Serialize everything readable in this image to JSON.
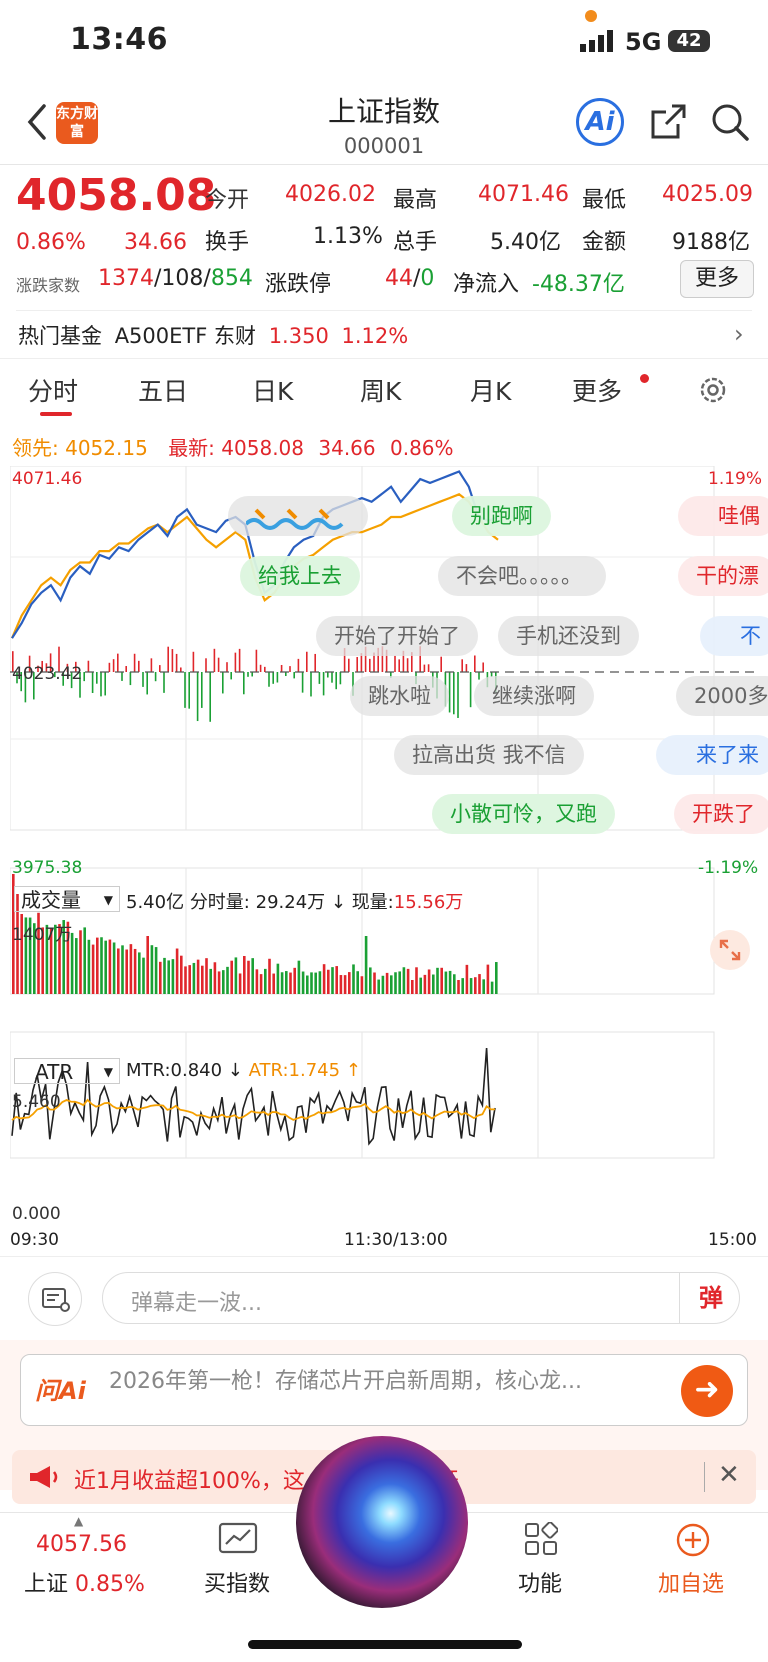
{
  "status_bar": {
    "time": "13:46",
    "network": "5G",
    "battery": "42"
  },
  "header": {
    "logo": "东方财富",
    "title": "上证指数",
    "code": "000001"
  },
  "quote": {
    "price": "4058.08",
    "change_pct": "0.86%",
    "change_amt": "34.66",
    "rows": [
      [
        {
          "label": "今开",
          "value": "4026.02"
        },
        {
          "label": "最高",
          "value": "4071.46"
        },
        {
          "label": "最低",
          "value": "4025.09"
        }
      ],
      [
        {
          "label": "换手",
          "value": "1.13%"
        },
        {
          "label": "总手",
          "value": "5.40亿"
        },
        {
          "label": "金额",
          "value": "9188亿"
        }
      ]
    ],
    "breadth_label": "涨跌家数",
    "breadth_up": "1374",
    "breadth_flat": "108",
    "breadth_down": "854",
    "limit_label": "涨跌停",
    "limit_up": "44",
    "limit_down": "0",
    "netflow_label": "净流入",
    "netflow_value": "-48.37亿",
    "more_button": "更多"
  },
  "hot_fund": {
    "label": "热门基金",
    "name": "A500ETF 东财",
    "price": "1.350",
    "pct": "1.12%"
  },
  "tabs": [
    "分时",
    "五日",
    "日K",
    "周K",
    "月K",
    "更多"
  ],
  "active_tab": "分时",
  "lead_line": {
    "lead_label": "领先:",
    "lead_value": "4052.15",
    "latest_label": "最新:",
    "latest_value": "4058.08",
    "latest_chg": "34.66",
    "latest_pct": "0.86%"
  },
  "chart_labels": {
    "high": "4071.46",
    "mid": "4023.42",
    "low": "3975.38",
    "high_pct": "1.19%",
    "low_pct": "-1.19%"
  },
  "danmaku": [
    {
      "text": "别跑啊",
      "style": "green"
    },
    {
      "text": "哇偶",
      "style": "red"
    },
    {
      "text": "给我上去",
      "style": "green"
    },
    {
      "text": "不会吧。。。。。",
      "style": "gray"
    },
    {
      "text": "干的漂",
      "style": "red"
    },
    {
      "text": "开始了开始了",
      "style": "gray"
    },
    {
      "text": "手机还没到",
      "style": "gray"
    },
    {
      "text": "不",
      "style": "blue"
    },
    {
      "text": "跳水啦",
      "style": "gray"
    },
    {
      "text": "继续涨啊",
      "style": "gray"
    },
    {
      "text": "2000多",
      "style": "gray"
    },
    {
      "text": "拉高出货 我不信",
      "style": "gray"
    },
    {
      "text": "来了来",
      "style": "blue"
    },
    {
      "text": "小散可怜，又跑",
      "style": "green"
    },
    {
      "text": "开跌了",
      "style": "red"
    }
  ],
  "volume_panel": {
    "selector": "成交量",
    "total": "5.40亿",
    "minute_label": "分时量:",
    "minute_value": "29.24万",
    "now_label": "现量:",
    "now_value": "15.56万",
    "max_label": "1407万"
  },
  "atr_panel": {
    "selector": "ATR",
    "mtr": "MTR:0.840",
    "atr": "ATR:1.745",
    "max_label": "5.460",
    "min_label": "0.000"
  },
  "time_axis": {
    "start": "09:30",
    "mid": "11:30/13:00",
    "end": "15:00"
  },
  "comment": {
    "placeholder": "弹幕走一波...",
    "danmu_button": "弹"
  },
  "ask_ai": {
    "logo": "问Ai",
    "text": "2026年第一枪！存储芯片开启新周期，核心龙..."
  },
  "banner": {
    "text": "近1月收益超100%，这",
    "text2": "公开"
  },
  "bottom_nav": {
    "index_value": "4057.56",
    "index_name": "上证",
    "index_pct": "0.85%",
    "buy_label": "买指数",
    "func_label": "功能",
    "add_label": "加自选"
  },
  "colors": {
    "up": "#e0262b",
    "down": "#1aa034",
    "accent": "#ea5a1e",
    "price_line": "#2a5fc0",
    "avg_line": "#f5a000"
  },
  "chart_data": {
    "type": "line",
    "x_start": "09:30",
    "x_end": "15:00",
    "ylim": [
      3975.38,
      4071.46
    ],
    "series": [
      {
        "name": "最新",
        "values": [
          4026,
          4030,
          4035,
          4038,
          4040,
          4036,
          4042,
          4045,
          4043,
          4048,
          4047,
          4050,
          4049,
          4052,
          4054,
          4056,
          4053,
          4058,
          4060,
          4056,
          4055,
          4054,
          4057,
          4058,
          4056,
          4046,
          4038,
          4040,
          4046,
          4050,
          4052,
          4053,
          4058,
          4060,
          4061,
          4062,
          4063,
          4062,
          4064,
          4066,
          4062,
          4065,
          4068,
          4067,
          4068,
          4069,
          4070,
          4066,
          4058,
          4057,
          4058
        ]
      },
      {
        "name": "领先",
        "values": [
          4026,
          4032,
          4036,
          4040,
          4042,
          4040,
          4044,
          4046,
          4046,
          4049,
          4049,
          4051,
          4051,
          4053,
          4055,
          4056,
          4054,
          4056,
          4058,
          4055,
          4052,
          4050,
          4052,
          4054,
          4052,
          4042,
          4036,
          4038,
          4042,
          4045,
          4047,
          4048,
          4050,
          4052,
          4053,
          4054,
          4054,
          4055,
          4056,
          4058,
          4058,
          4059,
          4060,
          4061,
          4062,
          4063,
          4064,
          4062,
          4058,
          4054,
          4052
        ]
      }
    ]
  }
}
